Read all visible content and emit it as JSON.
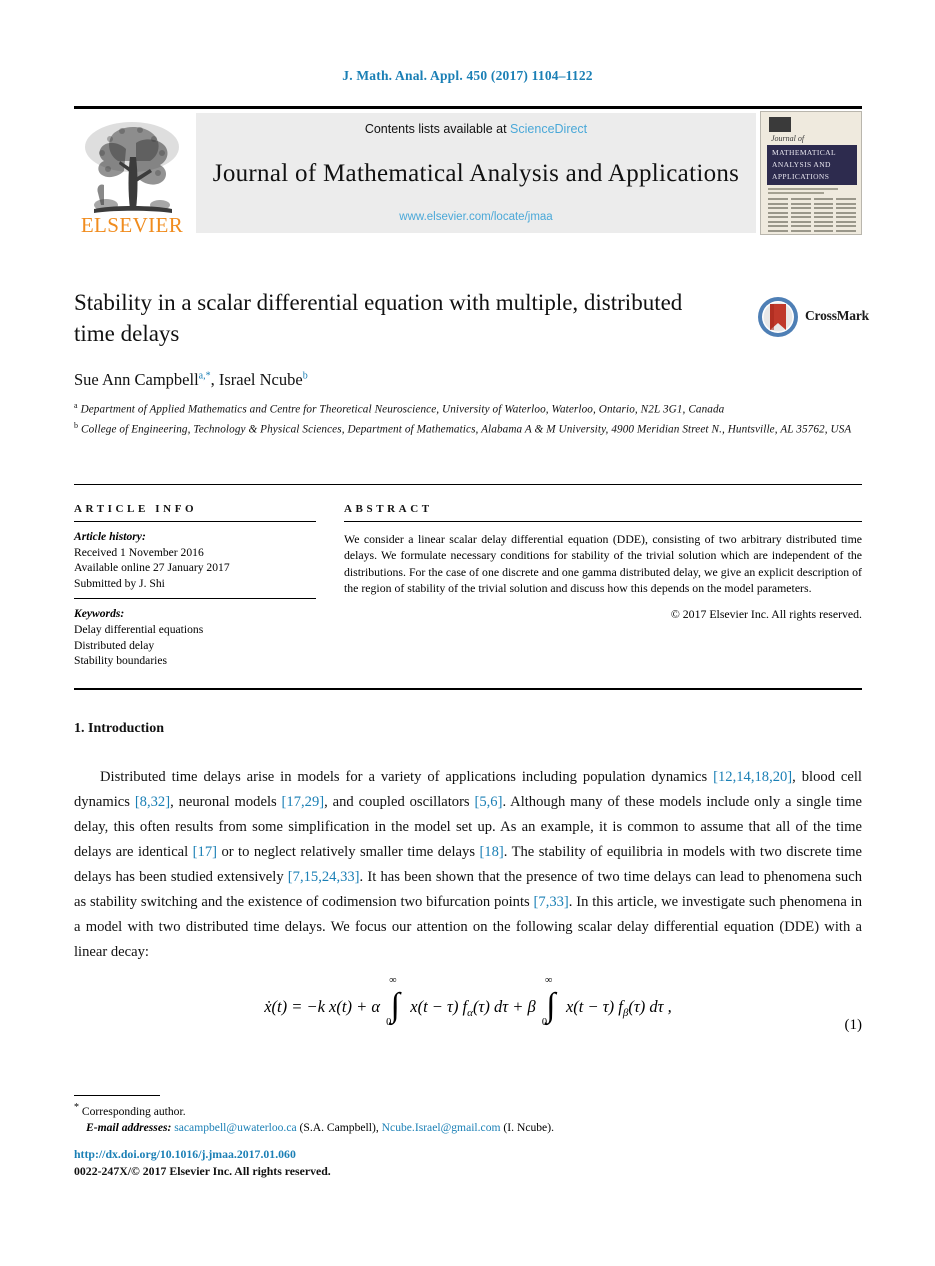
{
  "running_head": "J. Math. Anal. Appl. 450 (2017) 1104–1122",
  "masthead": {
    "contents_prefix": "Contents lists available at ",
    "sciencedirect": "ScienceDirect",
    "journal_title": "Journal of Mathematical Analysis and Applications",
    "journal_url": "www.elsevier.com/locate/jmaa",
    "publisher_logo_text": "ELSEVIER",
    "cover": {
      "journal_of": "Journal of",
      "band_title": "MATHEMATICAL ANALYSIS AND APPLICATIONS"
    }
  },
  "article": {
    "title": "Stability in a scalar differential equation with multiple, distributed time delays",
    "crossmark_label": "CrossMark",
    "authors_html": "Sue Ann Campbell<sup>a,*</sup>, Israel Ncube<sup>b</sup>",
    "affiliations": [
      {
        "marker": "a",
        "text": "Department of Applied Mathematics and Centre for Theoretical Neuroscience, University of Waterloo, Waterloo, Ontario, N2L 3G1, Canada"
      },
      {
        "marker": "b",
        "text": "College of Engineering, Technology & Physical Sciences, Department of Mathematics, Alabama A & M University, 4900 Meridian Street N., Huntsville, AL 35762, USA"
      }
    ]
  },
  "info_column": {
    "heading": "ARTICLE INFO",
    "history_label": "Article history:",
    "history": [
      "Received 1 November 2016",
      "Available online 27 January 2017",
      "Submitted by J. Shi"
    ],
    "keywords_label": "Keywords:",
    "keywords": [
      "Delay differential equations",
      "Distributed delay",
      "Stability boundaries"
    ]
  },
  "abstract_column": {
    "heading": "ABSTRACT",
    "text": "We consider a linear scalar delay differential equation (DDE), consisting of two arbitrary distributed time delays. We formulate necessary conditions for stability of the trivial solution which are independent of the distributions. For the case of one discrete and one gamma distributed delay, we give an explicit description of the region of stability of the trivial solution and discuss how this depends on the model parameters.",
    "copyright": "© 2017 Elsevier Inc. All rights reserved."
  },
  "section": {
    "number_title": "1. Introduction",
    "paragraph_parts": [
      {
        "t": "text",
        "v": "Distributed time delays arise in models for a variety of applications including population dynamics "
      },
      {
        "t": "ref",
        "v": "[12,14,18,20]"
      },
      {
        "t": "text",
        "v": ", blood cell dynamics "
      },
      {
        "t": "ref",
        "v": "[8,32]"
      },
      {
        "t": "text",
        "v": ", neuronal models "
      },
      {
        "t": "ref",
        "v": "[17,29]"
      },
      {
        "t": "text",
        "v": ", and coupled oscillators "
      },
      {
        "t": "ref",
        "v": "[5,6]"
      },
      {
        "t": "text",
        "v": ". Although many of these models include only a single time delay, this often results from some simplification in the model set up. As an example, it is common to assume that all of the time delays are identical "
      },
      {
        "t": "ref",
        "v": "[17]"
      },
      {
        "t": "text",
        "v": " or to neglect relatively smaller time delays "
      },
      {
        "t": "ref",
        "v": "[18]"
      },
      {
        "t": "text",
        "v": ". The stability of equilibria in models with two discrete time delays has been studied extensively "
      },
      {
        "t": "ref",
        "v": "[7,15,24,33]"
      },
      {
        "t": "text",
        "v": ". It has been shown that the presence of two time delays can lead to phenomena such as stability switching and the existence of codimension two bifurcation points "
      },
      {
        "t": "ref",
        "v": "[7,33]"
      },
      {
        "t": "text",
        "v": ". In this article, we investigate such phenomena in a model with two distributed time delays. We focus our attention on the following scalar delay differential equation (DDE) with a linear decay:"
      }
    ]
  },
  "equation": {
    "number": "(1)",
    "lhs": "ẋ(t) = −k x(t) + α",
    "integral_upper": "∞",
    "integral_lower": "0",
    "term1": "x(t − τ) f",
    "term1_sub": "α",
    "term1_tail": "(τ) dτ + β",
    "term2": "x(t − τ) f",
    "term2_sub": "β",
    "term2_tail": "(τ) dτ ,"
  },
  "footnotes": {
    "corresponding": "Corresponding author.",
    "email_label": "E-mail addresses:",
    "emails": [
      {
        "address": "sacampbell@uwaterloo.ca",
        "owner": "(S.A. Campbell)"
      },
      {
        "address": "Ncube.Israel@gmail.com",
        "owner": "(I. Ncube)"
      }
    ],
    "doi": "http://dx.doi.org/10.1016/j.jmaa.2017.01.060",
    "issn_line": "0022-247X/© 2017 Elsevier Inc. All rights reserved."
  },
  "colors": {
    "link_blue": "#1a7fb5",
    "sciencedirect_blue": "#4aa8d8",
    "elsevier_orange": "#f08c1e",
    "cover_band": "#2d2b4e"
  }
}
